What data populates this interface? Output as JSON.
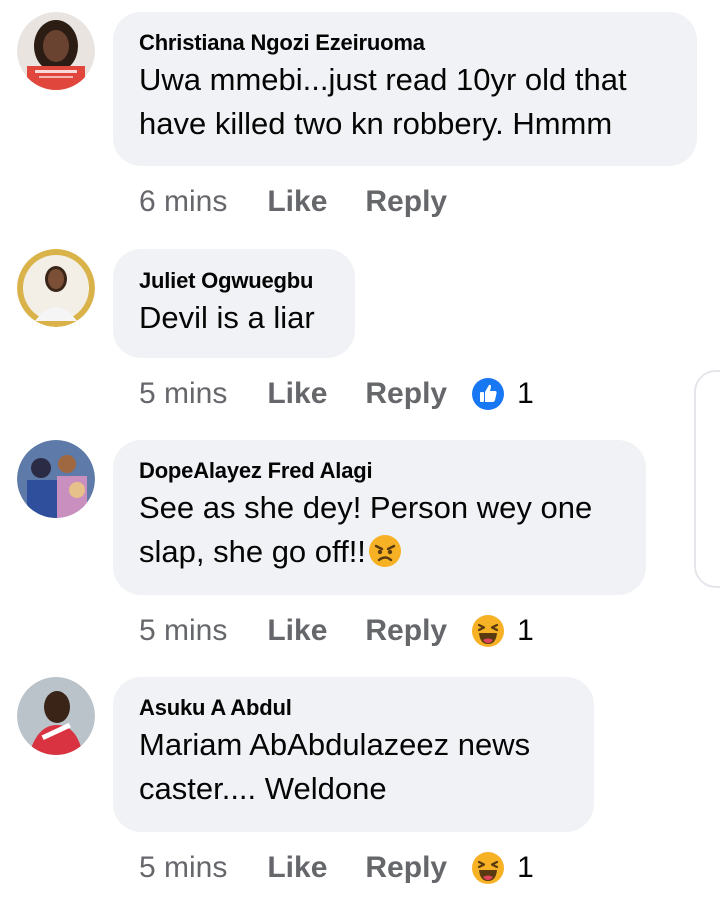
{
  "comments": [
    {
      "author": "Christiana Ngozi Ezeiruoma",
      "lines": [
        "Uwa mmebi...just read 10yr old that",
        "have killed two kn robbery. Hmmm"
      ],
      "time": "6 mins",
      "like_label": "Like",
      "reply_label": "Reply",
      "reaction": null,
      "reaction_count": ""
    },
    {
      "author": "Juliet Ogwuegbu",
      "lines": [
        "Devil is a liar"
      ],
      "time": "5 mins",
      "like_label": "Like",
      "reply_label": "Reply",
      "reaction": "like-reaction-icon",
      "reaction_count": "1"
    },
    {
      "author": "DopeAlayez Fred Alagi",
      "lines": [
        "See as she dey! Person wey one",
        "slap, she go off!!"
      ],
      "trailing_emoji": "angry-face-emoji",
      "time": "5 mins",
      "like_label": "Like",
      "reply_label": "Reply",
      "reaction": "haha-reaction-icon",
      "reaction_count": "1"
    },
    {
      "author": "Asuku A Abdul",
      "lines": [
        "Mariam AbAbdulazeez news",
        "caster.... Weldone"
      ],
      "time": "5 mins",
      "like_label": "Like",
      "reply_label": "Reply",
      "reaction": "haha-reaction-icon",
      "reaction_count": "1"
    }
  ],
  "colors": {
    "bubble": "#f0f2f5",
    "meta_text": "#65676b",
    "text": "#050505",
    "like_blue": "#1877f2",
    "haha_yellow": "#f7b125"
  }
}
